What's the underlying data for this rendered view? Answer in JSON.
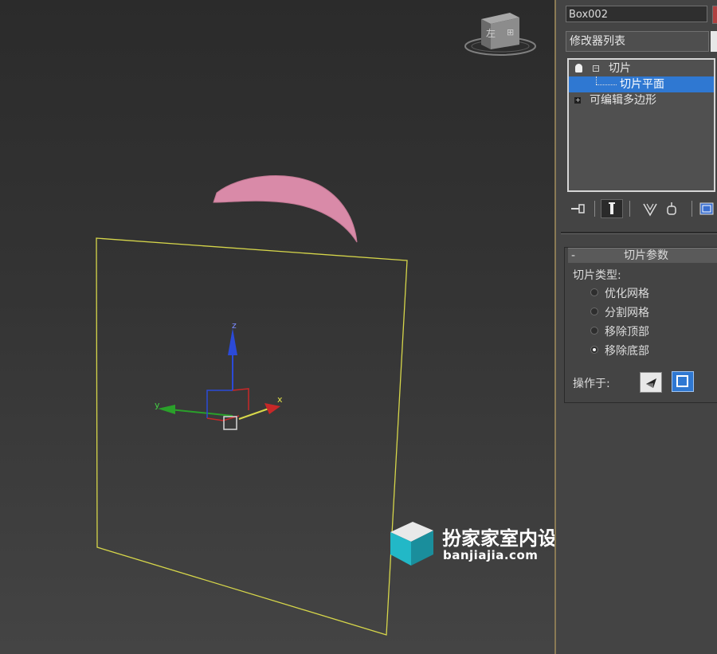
{
  "viewport": {
    "object_color": "#d98aa8",
    "plane_color": "#d6d64a",
    "axis_x_label": "x",
    "axis_y_label": "y",
    "axis_z_label": "z",
    "viewcube_label": "左"
  },
  "panel": {
    "object_name": "Box002",
    "modifier_list_label": "修改器列表",
    "stack": {
      "slice": "切片",
      "slice_plane": "切片平面",
      "editable_poly": "可编辑多边形"
    },
    "toolbar": {
      "pin_icon": "pin-stack-icon",
      "show_end_icon": "show-end-result-icon",
      "unique_icon": "make-unique-icon",
      "remove_icon": "remove-modifier-icon",
      "config_icon": "configure-modifier-sets-icon"
    },
    "rollout": {
      "collapse_symbol": "-",
      "title": "切片参数",
      "slice_type_label": "切片类型:",
      "options": [
        "优化网格",
        "分割网格",
        "移除顶部",
        "移除底部"
      ],
      "selected_option": "移除底部",
      "operate_on_label": "操作于:"
    }
  },
  "watermark": {
    "brand": "扮家家室内设计",
    "url": "banjiajia.com"
  }
}
